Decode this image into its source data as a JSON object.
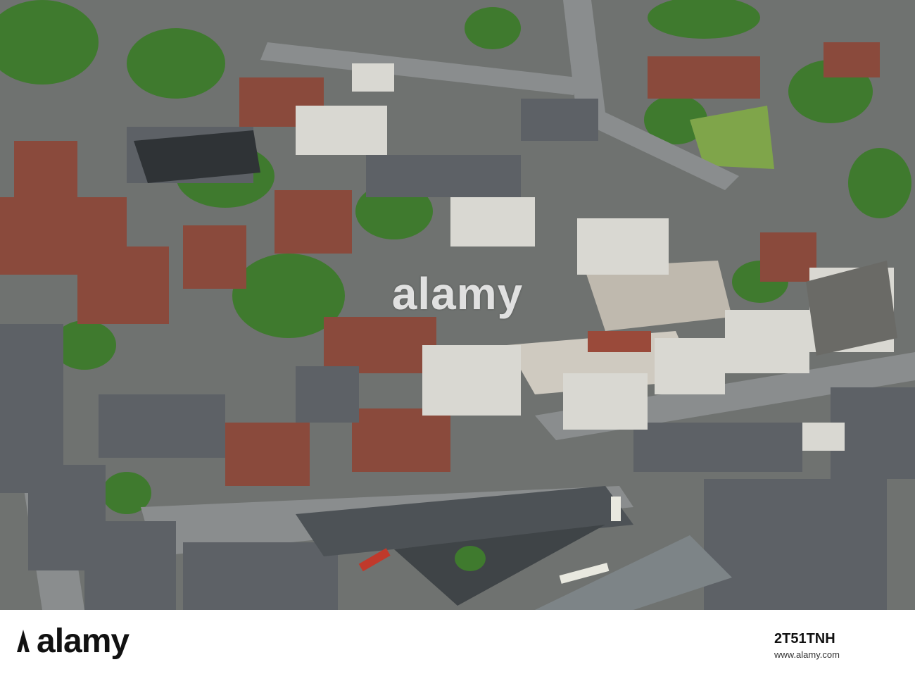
{
  "photo": {
    "subject": "aerial-city-photo",
    "palette": {
      "roof_red": "#8a4a3c",
      "roof_grey": "#5d6166",
      "tree_green": "#3f7a2e",
      "road": "#777a7c",
      "plaza": "#cfcac0",
      "lawn": "#7fa54a"
    }
  },
  "watermark": {
    "text": "alamy"
  },
  "footer": {
    "logo": "alamy",
    "image_id": "2T51TNH",
    "url": "www.alamy.com"
  }
}
